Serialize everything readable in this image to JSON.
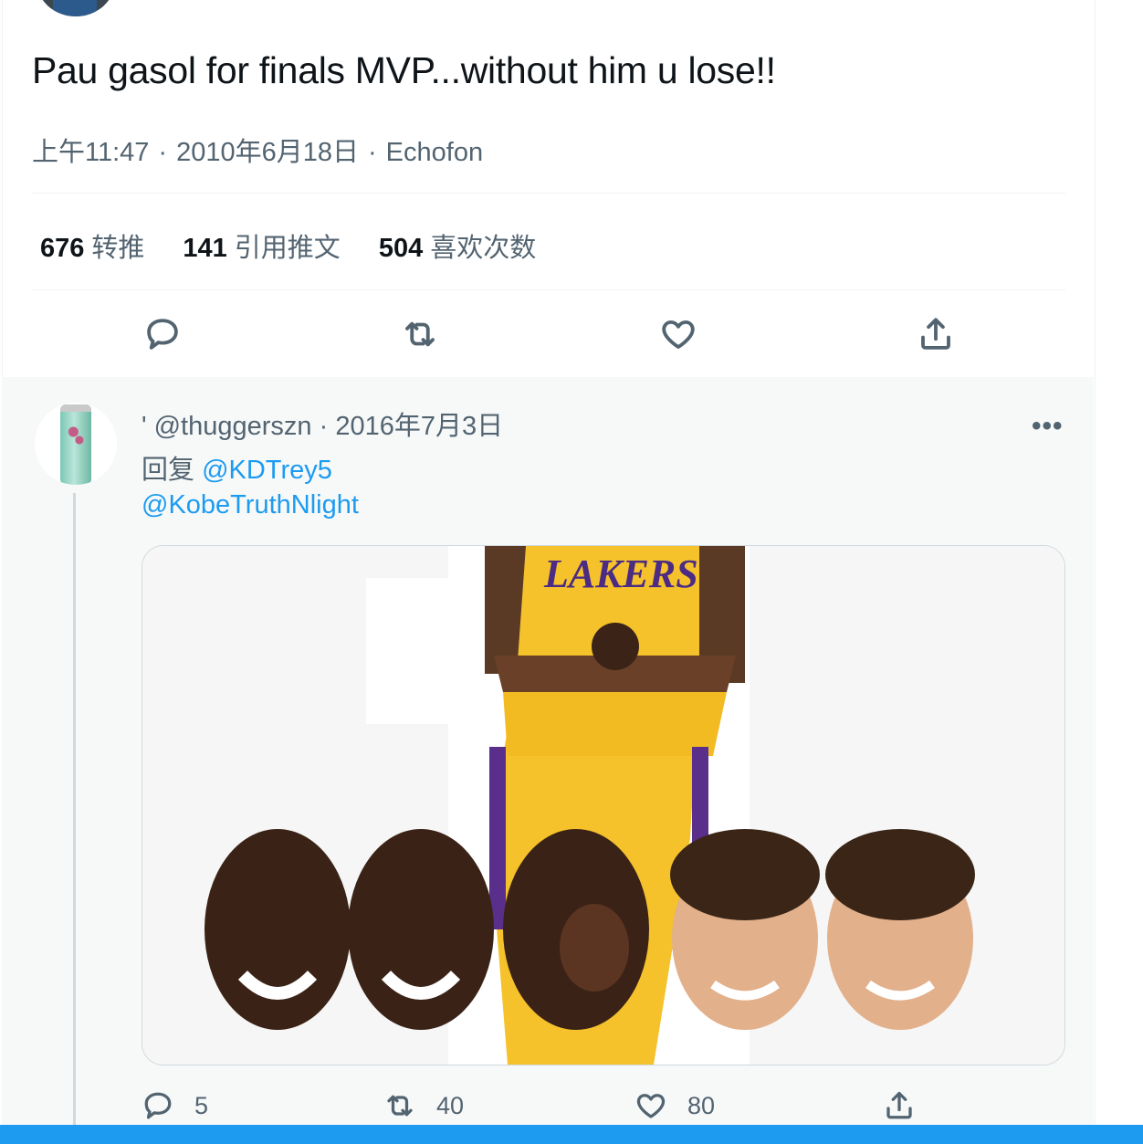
{
  "main_tweet": {
    "text": "Pau gasol for finals MVP...without him u lose!!",
    "time": "上午11:47",
    "date": "2010年6月18日",
    "source": "Echofon",
    "separator": "·",
    "stats": {
      "retweets_count": "676",
      "retweets_label": "转推",
      "quotes_count": "141",
      "quotes_label": "引用推文",
      "likes_count": "504",
      "likes_label": "喜欢次数"
    },
    "action_icons": [
      "reply-icon",
      "retweet-icon",
      "like-icon",
      "share-icon"
    ]
  },
  "reply": {
    "handle": "@thuggerszn",
    "date": "2016年7月3日",
    "prefix_mark": "'",
    "separator": "·",
    "replying_label": "回复",
    "replying_to": "@KDTrey5",
    "mention": "@KobeTruthNlight",
    "more_label": "•••",
    "counts": {
      "replies": "5",
      "retweets": "40",
      "likes": "80"
    }
  },
  "colors": {
    "link": "#1d9bf0",
    "secondary_text": "#536471",
    "reply_bg": "#f7f9f9"
  }
}
